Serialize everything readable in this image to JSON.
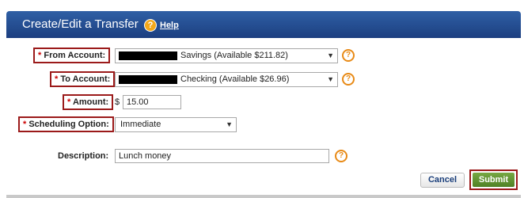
{
  "header": {
    "title": "Create/Edit a Transfer",
    "help_icon_glyph": "?",
    "help_label": "Help"
  },
  "form": {
    "from_account": {
      "label": "From Account:",
      "required_marker": "*",
      "value": "Savings (Available $211.82)",
      "help_glyph": "?"
    },
    "to_account": {
      "label": "To Account:",
      "required_marker": "*",
      "value": "Checking (Available $26.96)",
      "help_glyph": "?"
    },
    "amount": {
      "label": "Amount:",
      "required_marker": "*",
      "currency": "$",
      "value": "15.00"
    },
    "scheduling": {
      "label": "Scheduling Option:",
      "required_marker": "*",
      "value": "Immediate"
    },
    "description": {
      "label": "Description:",
      "value": "Lunch money",
      "help_glyph": "?"
    }
  },
  "actions": {
    "cancel_label": "Cancel",
    "submit_label": "Submit"
  },
  "colors": {
    "header": "#2f5fa5",
    "required_outline": "#9b1a1a",
    "submit": "#5f9232",
    "help_icon": "#e88a16"
  }
}
